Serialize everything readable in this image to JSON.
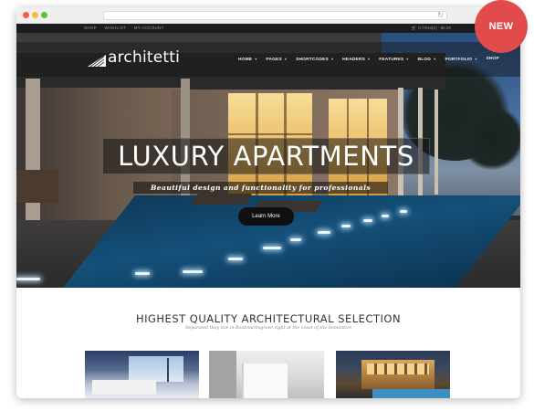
{
  "badge": {
    "label": "NEW"
  },
  "topbar": {
    "links": [
      "SHOP",
      "WISHLIST",
      "MY ACCOUNT"
    ],
    "cart": "0 ITEM(S) - $0.00"
  },
  "brand": {
    "name": "architetti"
  },
  "menu": [
    {
      "label": "HOME",
      "dropdown": true
    },
    {
      "label": "PAGES",
      "dropdown": true
    },
    {
      "label": "SHORTCODES",
      "dropdown": true
    },
    {
      "label": "HEADERS",
      "dropdown": true
    },
    {
      "label": "FEATURES",
      "dropdown": true
    },
    {
      "label": "BLOG",
      "dropdown": true
    },
    {
      "label": "PORTFOLIO",
      "dropdown": true
    },
    {
      "label": "SHOP",
      "dropdown": false
    }
  ],
  "hero": {
    "title": "LUXURY APARTMENTS",
    "subtitle": "Beautiful design and functionality for professionals",
    "button": "Learn More"
  },
  "section": {
    "title": "HIGHEST QUALITY ARCHITECTURAL SELECTION",
    "subtitle": "Separated they live in Bookmarksgrove right at the coast of the Semantics"
  },
  "colors": {
    "badge": "#e14b4b",
    "topbar": "#1c1d20",
    "accent_icon": "#3aa0d8"
  }
}
